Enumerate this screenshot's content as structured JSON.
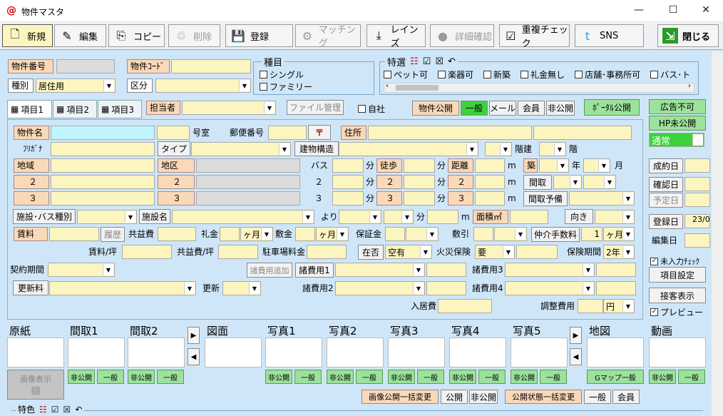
{
  "window": {
    "icon": "@",
    "title": "物件マスタ",
    "minimize": "—",
    "maximize": "☐",
    "close": "✕"
  },
  "toolbar": {
    "new": "新規",
    "edit": "編集",
    "copy": "コピー",
    "delete": "削除",
    "register": "登録",
    "matching": "マッチング",
    "reins": "レインズ",
    "detail_check": "詳細確認",
    "dup_check": "重複チェック",
    "sns": "SNS",
    "close": "閉じる"
  },
  "form": {
    "property_no": "物件番号",
    "property_code": "物件ｺｰﾄﾞ",
    "kind_label": "種別",
    "kind_value": "居住用",
    "section_label": "区分",
    "types_title": "種目",
    "type_single": "シングル",
    "type_family": "ファミリー",
    "special_title": "特選",
    "special_items": [
      "ペット可",
      "楽器可",
      "新築",
      "礼金無し",
      "店舗･事務所可",
      "バス･ト"
    ],
    "tabs": [
      "項目1",
      "項目2",
      "項目3"
    ],
    "tanto": "担当者",
    "file_mgmt": "ファイル管理",
    "own_company": "自社",
    "publish_label": "物件公開",
    "pub_general": "一般",
    "pub_mail": "メール",
    "pub_member": "会員",
    "pub_private": "非公開",
    "portal": "ﾎﾟｰﾀﾙ公開",
    "name_label": "物件名",
    "room": "号室",
    "postal": "郵便番号",
    "postal_mark": "〒",
    "address": "住所",
    "kana": "ﾌﾘｶﾞﾅ",
    "type_btn": "タイプ",
    "structure_btn": "建物構造",
    "floors": "階建",
    "floor": "階",
    "area_label": "地域",
    "district": "地区",
    "bus": "バス",
    "fun": "分",
    "walk": "徒歩",
    "distance": "距離",
    "meter": "m",
    "built": "築",
    "year": "年",
    "month": "月",
    "row2": "２",
    "row3": "３",
    "madori": "間取",
    "madori_plan": "間取予備",
    "facility": "施設･バス種別",
    "facility_name": "施設名",
    "yori": "より",
    "area_m2": "面積㎡",
    "direction": "向き",
    "rent": "賃料",
    "history": "履歴",
    "common_fee": "共益費",
    "key_money": "礼金",
    "months": "ヶ月",
    "deposit": "敷金",
    "guarantee": "保証金",
    "shikibiki": "敷引",
    "brokerage": "仲介手数料",
    "brokerage_val": "1",
    "rent_per_tsubo": "賃料/坪",
    "common_per_tsubo": "共益費/坪",
    "parking": "駐車場料金",
    "availability": "在否",
    "availability_val": "空有",
    "fire_ins": "火災保険",
    "fire_val": "要",
    "ins_period": "保険期間",
    "ins_val": "2年",
    "contract_period": "契約期間",
    "add_fee": "諸費用追加",
    "fee1": "諸費用1",
    "fee2": "諸費用2",
    "fee3": "諸費用3",
    "fee4": "諸費用4",
    "renewal": "更新料",
    "renewal_label": "更新",
    "move_in": "入居費",
    "adjust": "調整費用",
    "yen": "円"
  },
  "right": {
    "ad_status": "広告不可",
    "hp_status": "HP未公開",
    "status_val": "通常",
    "contract_date": "成約日",
    "confirm_date": "確認日",
    "scheduled_date": "予定日",
    "register_date": "登録日",
    "register_val": "23/0",
    "edit_date": "編集日",
    "unentered_check": "未入力ﾁｪｯｸ",
    "item_settings": "項目設定",
    "reception": "接客表示",
    "preview": "プレビュー"
  },
  "photos": {
    "labels": [
      "原紙",
      "間取1",
      "間取2",
      "図面",
      "写真1",
      "写真2",
      "写真3",
      "写真4",
      "写真5",
      "地図",
      "動画"
    ],
    "image_display": "画像表示",
    "private": "非公開",
    "general": "一般",
    "gmap_general": "Gマップ一般",
    "bulk_image": "画像公開一括変更",
    "public": "公開",
    "non_public": "非公開",
    "bulk_status": "公開状態一括変更",
    "member": "会員"
  },
  "bottom": {
    "tokushoku": "特色"
  }
}
